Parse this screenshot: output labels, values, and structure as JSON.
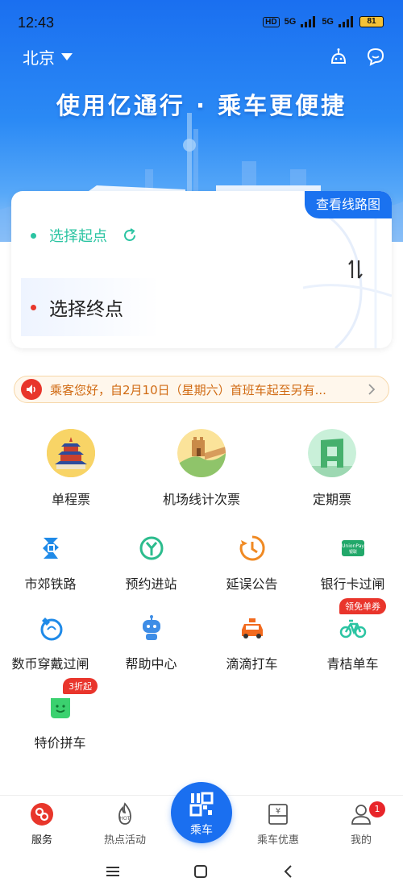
{
  "status_bar": {
    "time": "12:43",
    "hd": "HD",
    "net1": "5G",
    "net2": "5G",
    "battery": "81"
  },
  "header": {
    "city": "北京",
    "slogan": "使用亿通行 · 乘车更便捷"
  },
  "route_card": {
    "map_button": "查看线路图",
    "start_label": "选择起点",
    "end_label": "选择终点"
  },
  "notice": {
    "text": "乘客您好，自2月10日（星期六）首班车起至另有..."
  },
  "tickets": [
    {
      "label": "单程票",
      "icon": "temple-icon"
    },
    {
      "label": "机场线计次票",
      "icon": "great-wall-icon"
    },
    {
      "label": "定期票",
      "icon": "cctv-building-icon"
    }
  ],
  "services": [
    {
      "label": "市郊铁路",
      "icon": "suburban-rail-icon"
    },
    {
      "label": "预约进站",
      "icon": "reservation-icon"
    },
    {
      "label": "延误公告",
      "icon": "delay-clock-icon"
    },
    {
      "label": "银行卡过闸",
      "icon": "unionpay-icon"
    },
    {
      "label": "数币穿戴过闸",
      "icon": "wearable-icon"
    },
    {
      "label": "帮助中心",
      "icon": "robot-icon"
    },
    {
      "label": "滴滴打车",
      "icon": "taxi-icon"
    },
    {
      "label": "青桔单车",
      "icon": "bike-icon",
      "badge": "领免单券"
    },
    {
      "label": "特价拼车",
      "icon": "carpool-icon",
      "badge": "3折起"
    }
  ],
  "bottom_nav": {
    "service": "服务",
    "hot": "热点活动",
    "ride": "乘车",
    "offers": "乘车优惠",
    "mine": "我的",
    "mine_badge": "1",
    "hot_icon_text": "HOT",
    "offers_icon_text": "¥"
  },
  "colors": {
    "brand_blue": "#1a6ff0",
    "teal": "#2bc4a2",
    "notice_orange": "#d06a12",
    "alert_red": "#e8362b"
  }
}
